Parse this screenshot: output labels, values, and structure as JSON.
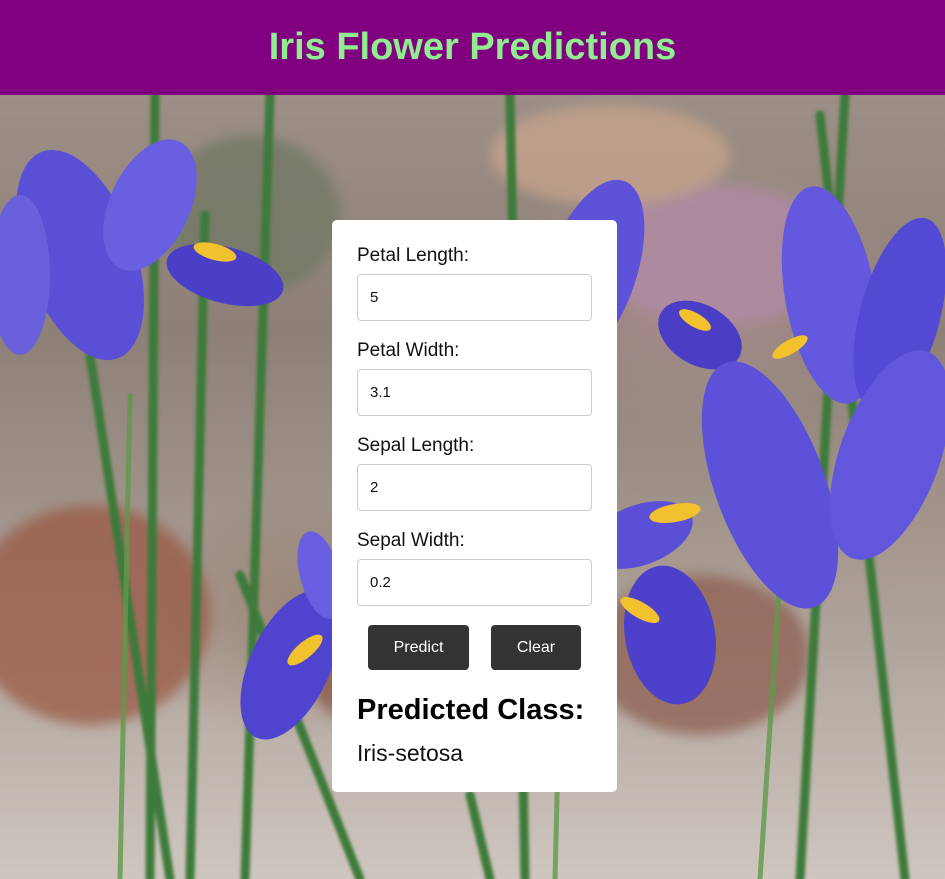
{
  "header": {
    "title": "Iris Flower Predictions"
  },
  "form": {
    "fields": [
      {
        "label": "Petal Length:",
        "value": "5"
      },
      {
        "label": "Petal Width:",
        "value": "3.1"
      },
      {
        "label": "Sepal Length:",
        "value": "2"
      },
      {
        "label": "Sepal Width:",
        "value": "0.2"
      }
    ],
    "predict_label": "Predict",
    "clear_label": "Clear"
  },
  "result": {
    "title": "Predicted Class:",
    "value": "Iris-setosa"
  },
  "colors": {
    "header_bg": "#800080",
    "title_text": "#90ee90",
    "button_bg": "#333333",
    "iris_petal": "#5b4fd6"
  },
  "background": {
    "icon": "iris-flowers-photo"
  }
}
